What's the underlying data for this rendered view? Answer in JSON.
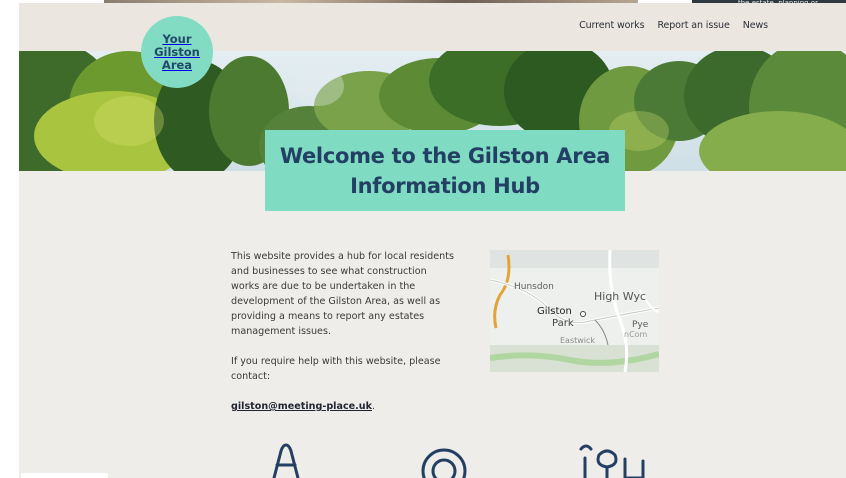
{
  "top_strip_right_text": "the estate, planning or ...",
  "logo": {
    "text": "Your\nGilston\nArea"
  },
  "nav": {
    "items": [
      "Current works",
      "Report an issue",
      "News"
    ]
  },
  "hero": {
    "title": "Welcome to the Gilston Area Information Hub"
  },
  "intro": {
    "paragraph1": "This website provides a hub for local residents and businesses to see what construction works are due to be undertaken in the development of the Gilston Area, as well as providing a means to report any estates management issues.",
    "paragraph2": "If you require help with this website, please contact:",
    "email": "gilston@meeting-place.uk",
    "email_suffix": "."
  },
  "map": {
    "labels": [
      "Hunsdon",
      "High Wyc",
      "Gilston",
      "Park",
      "Pye",
      "Eastwick",
      "nCom"
    ]
  },
  "colors": {
    "accent": "#7fdcc3",
    "navy": "#233f63",
    "header_bg": "#ece6e1",
    "page_bg": "#efedea"
  },
  "feature_icons": [
    "traffic-cone-icon",
    "location-pin-icon",
    "trees-icon"
  ]
}
